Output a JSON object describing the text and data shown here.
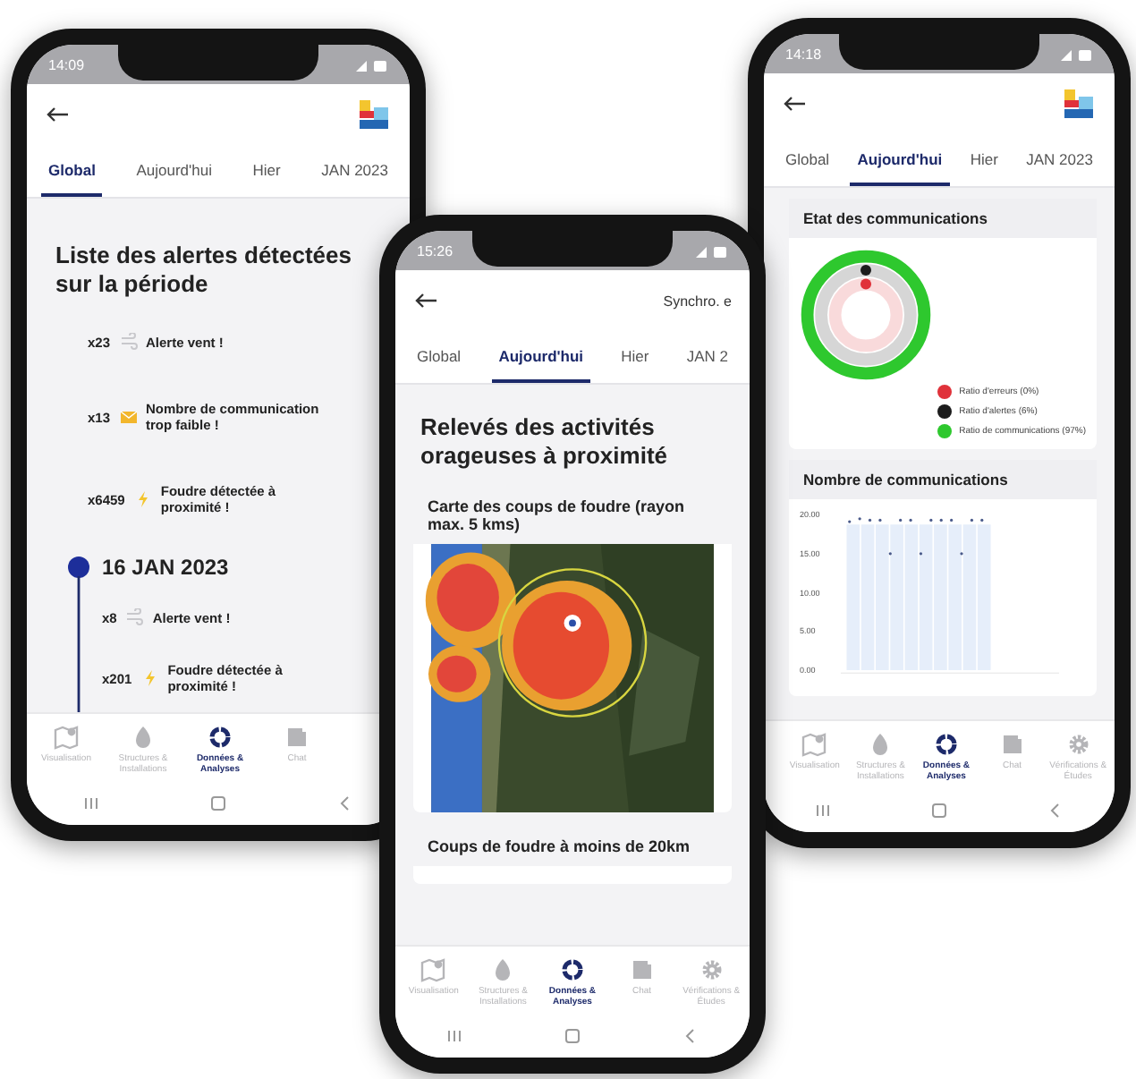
{
  "phones": [
    {
      "status_time": "14:09",
      "logo": true,
      "tabs": [
        {
          "label": "Global",
          "selected": true
        },
        {
          "label": "Aujourd'hui",
          "selected": false
        },
        {
          "label": "Hier",
          "selected": false
        },
        {
          "label": "JAN 2023",
          "selected": false
        }
      ],
      "content": {
        "kind": "alerts",
        "title": "Liste des alertes détectées sur la période",
        "alerts": [
          {
            "count": "x23",
            "kind": "wind",
            "text": "Alerte vent !"
          },
          {
            "count": "x13",
            "kind": "message",
            "text": "Nombre de communication trop faible !"
          },
          {
            "count": "x6459",
            "kind": "lightning",
            "text": "Foudre détectée à proximité !"
          }
        ],
        "timeline": {
          "date": "16 JAN 2023",
          "alerts": [
            {
              "count": "x8",
              "kind": "wind",
              "text": "Alerte vent !"
            },
            {
              "count": "x201",
              "kind": "lightning",
              "text": "Foudre détectée à proximité !"
            }
          ]
        }
      },
      "nav": [
        {
          "label": "Visualisation",
          "selected": false
        },
        {
          "label": "Structures & Installations",
          "selected": false
        },
        {
          "label": "Données & Analyses",
          "selected": true
        },
        {
          "label": "Chat",
          "selected": false
        }
      ]
    },
    {
      "status_time": "15:26",
      "sync_text": "Synchro. e",
      "tabs": [
        {
          "label": "Global",
          "selected": false
        },
        {
          "label": "Aujourd'hui",
          "selected": true
        },
        {
          "label": "Hier",
          "selected": false
        },
        {
          "label": "JAN 2",
          "selected": false
        }
      ],
      "content": {
        "kind": "storms",
        "title": "Relevés des activités orageuses à proximité",
        "map_title": "Carte des coups de foudre (rayon max. 5 kms)",
        "list_title": "Coups de foudre à moins de 20km"
      },
      "nav": [
        {
          "label": "Visualisation",
          "selected": false
        },
        {
          "label": "Structures & Installations",
          "selected": false
        },
        {
          "label": "Données & Analyses",
          "selected": true
        },
        {
          "label": "Chat",
          "selected": false
        },
        {
          "label": "Vérifications & Études",
          "selected": false
        }
      ]
    },
    {
      "status_time": "14:18",
      "logo": true,
      "tabs": [
        {
          "label": "Global",
          "selected": false
        },
        {
          "label": "Aujourd'hui",
          "selected": true
        },
        {
          "label": "Hier",
          "selected": false
        },
        {
          "label": "JAN 2023",
          "selected": false
        }
      ],
      "content": {
        "kind": "communications",
        "status_title": "Etat des communications",
        "legend": [
          {
            "label": "Ratio d'erreurs (0%)",
            "color": "#e0323a"
          },
          {
            "label": "Ratio d'alertes (6%)",
            "color": "#1c1c1c"
          },
          {
            "label": "Ratio de communications (97%)",
            "color": "#2ec82e"
          }
        ],
        "chart_title": "Nombre de communications",
        "y_labels": [
          "20.00",
          "15.00",
          "10.00",
          "5.00",
          "0.00"
        ]
      },
      "nav": [
        {
          "label": "Visualisation",
          "selected": false
        },
        {
          "label": "Structures & Installations",
          "selected": false
        },
        {
          "label": "Données & Analyses",
          "selected": true
        },
        {
          "label": "Chat",
          "selected": false
        },
        {
          "label": "Vérifications & Études",
          "selected": false
        }
      ]
    }
  ]
}
